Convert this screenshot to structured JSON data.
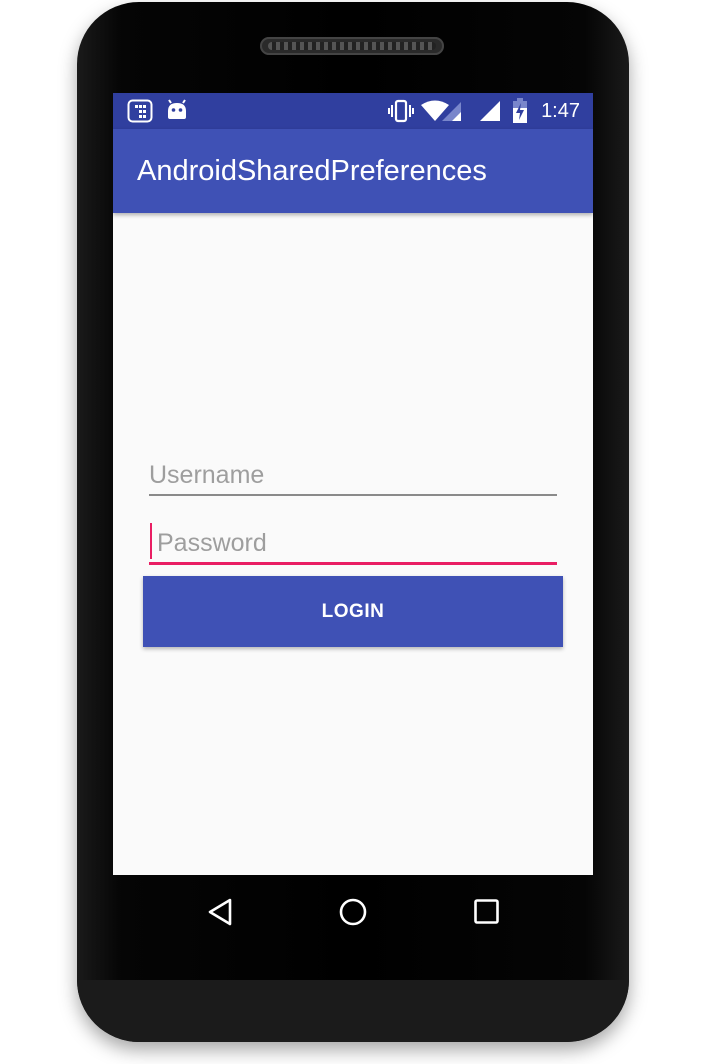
{
  "status_bar": {
    "time": "1:47",
    "left_icons": [
      "sim-toolkit-icon",
      "android-icon"
    ],
    "right_icons": [
      "vibrate-icon",
      "wifi-icon",
      "signal-icon",
      "battery-charging-icon"
    ]
  },
  "app_bar": {
    "title": "AndroidSharedPreferences"
  },
  "form": {
    "username_placeholder": "Username",
    "username_value": "",
    "password_placeholder": "Password",
    "password_value": "",
    "login_label": "LOGIN"
  },
  "nav_bar": {
    "buttons": [
      "back-icon",
      "home-icon",
      "recents-icon"
    ]
  },
  "colors": {
    "primary": "#3f51b5",
    "primary_dark": "#303f9f",
    "accent": "#e91e63",
    "background": "#fafafa"
  }
}
